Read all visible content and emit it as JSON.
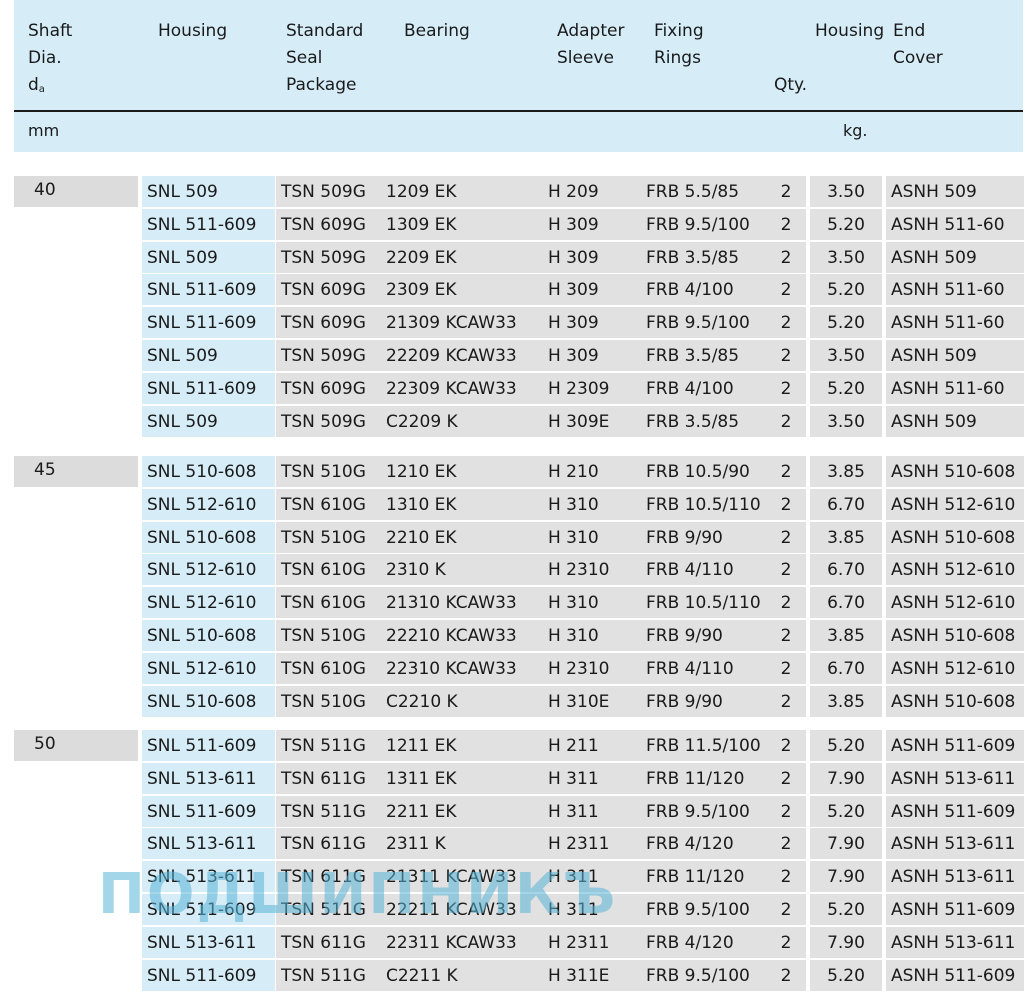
{
  "header": {
    "shaft": [
      "Shaft",
      "Dia.",
      "d"
    ],
    "shaft_sub": "a",
    "housing": "Housing",
    "seal": [
      "Standard",
      "Seal",
      "Package"
    ],
    "bearing": "Bearing",
    "adapter": [
      "Adapter",
      "Sleeve"
    ],
    "fixing": [
      "Fixing",
      "Rings"
    ],
    "qty": "Qty.",
    "housing_weight": "Housing",
    "end_cover": [
      "End",
      "Cover"
    ],
    "unit_mm": "mm",
    "unit_kg": "kg."
  },
  "groups": [
    {
      "dia": "40",
      "rows": [
        [
          "SNL 509",
          "TSN 509G",
          "1209 EK",
          "H 209",
          "FRB 5.5/85",
          "2",
          "3.50",
          "ASNH 509"
        ],
        [
          "SNL 511-609",
          "TSN 609G",
          "1309 EK",
          "H 309",
          "FRB 9.5/100",
          "2",
          "5.20",
          "ASNH 511-60"
        ],
        [
          "SNL 509",
          "TSN 509G",
          "2209 EK",
          "H 309",
          "FRB 3.5/85",
          "2",
          "3.50",
          "ASNH 509"
        ],
        [
          "SNL 511-609",
          "TSN 609G",
          "2309 EK",
          "H 309",
          "FRB 4/100",
          "2",
          "5.20",
          "ASNH 511-60"
        ],
        [
          "SNL 511-609",
          "TSN 609G",
          "21309 KCAW33",
          "H 309",
          "FRB 9.5/100",
          "2",
          "5.20",
          "ASNH 511-60"
        ],
        [
          "SNL 509",
          "TSN 509G",
          "22209 KCAW33",
          "H 309",
          "FRB 3.5/85",
          "2",
          "3.50",
          "ASNH 509"
        ],
        [
          "SNL 511-609",
          "TSN 609G",
          "22309 KCAW33",
          "H 2309",
          "FRB 4/100",
          "2",
          "5.20",
          "ASNH 511-60"
        ],
        [
          "SNL 509",
          "TSN 509G",
          "C2209 K",
          "H 309E",
          "FRB 3.5/85",
          "2",
          "3.50",
          "ASNH 509"
        ]
      ]
    },
    {
      "dia": "45",
      "rows": [
        [
          "SNL 510-608",
          "TSN 510G",
          "1210 EK",
          "H 210",
          "FRB 10.5/90",
          "2",
          "3.85",
          "ASNH 510-608"
        ],
        [
          "SNL 512-610",
          "TSN 610G",
          "1310 EK",
          "H 310",
          "FRB 10.5/110",
          "2",
          "6.70",
          "ASNH 512-610"
        ],
        [
          "SNL 510-608",
          "TSN 510G",
          "2210 EK",
          "H 310",
          "FRB 9/90",
          "2",
          "3.85",
          "ASNH 510-608"
        ],
        [
          "SNL 512-610",
          "TSN 610G",
          "2310 K",
          "H 2310",
          "FRB 4/110",
          "2",
          "6.70",
          "ASNH 512-610"
        ],
        [
          "SNL 512-610",
          "TSN 610G",
          "21310 KCAW33",
          "H 310",
          "FRB 10.5/110",
          "2",
          "6.70",
          "ASNH 512-610"
        ],
        [
          "SNL 510-608",
          "TSN 510G",
          "22210 KCAW33",
          "H 310",
          "FRB 9/90",
          "2",
          "3.85",
          "ASNH 510-608"
        ],
        [
          "SNL 512-610",
          "TSN 610G",
          "22310 KCAW33",
          "H 2310",
          "FRB 4/110",
          "2",
          "6.70",
          "ASNH 512-610"
        ],
        [
          "SNL 510-608",
          "TSN 510G",
          "C2210 K",
          "H 310E",
          "FRB 9/90",
          "2",
          "3.85",
          "ASNH 510-608"
        ]
      ]
    },
    {
      "dia": "50",
      "rows": [
        [
          "SNL 511-609",
          "TSN 511G",
          "1211 EK",
          "H 211",
          "FRB 11.5/100",
          "2",
          "5.20",
          "ASNH 511-609"
        ],
        [
          "SNL 513-611",
          "TSN 611G",
          "1311 EK",
          "H 311",
          "FRB 11/120",
          "2",
          "7.90",
          "ASNH 513-611"
        ],
        [
          "SNL 511-609",
          "TSN 511G",
          "2211 EK",
          "H 311",
          "FRB 9.5/100",
          "2",
          "5.20",
          "ASNH 511-609"
        ],
        [
          "SNL 513-611",
          "TSN 611G",
          "2311 K",
          "H 2311",
          "FRB 4/120",
          "2",
          "7.90",
          "ASNH 513-611"
        ],
        [
          "SNL 513-611",
          "TSN 611G",
          "21311 KCAW33",
          "H 311",
          "FRB 11/120",
          "2",
          "7.90",
          "ASNH 513-611"
        ],
        [
          "SNL 511-609",
          "TSN 511G",
          "22211 KCAW33",
          "H 311",
          "FRB 9.5/100",
          "2",
          "5.20",
          "ASNH 511-609"
        ],
        [
          "SNL 513-611",
          "TSN 611G",
          "22311 KCAW33",
          "H 2311",
          "FRB 4/120",
          "2",
          "7.90",
          "ASNH 513-611"
        ],
        [
          "SNL 511-609",
          "TSN 511G",
          "C2211 K",
          "H 311E",
          "FRB 9.5/100",
          "2",
          "5.20",
          "ASNH 511-609"
        ]
      ]
    }
  ],
  "watermark": "ПОДШИПНИКЪ"
}
